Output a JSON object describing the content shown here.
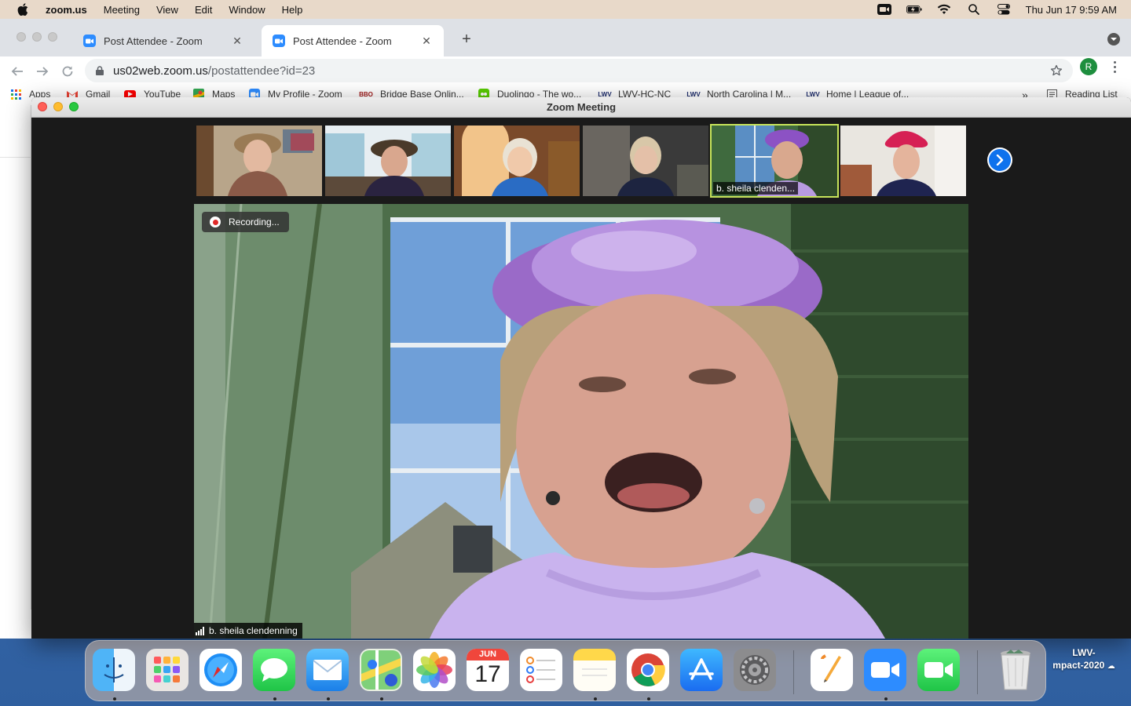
{
  "menubar": {
    "app_name": "zoom.us",
    "menus": [
      "Meeting",
      "View",
      "Edit",
      "Window",
      "Help"
    ],
    "datetime": "Thu Jun 17  9:59 AM"
  },
  "browser": {
    "tabs": [
      {
        "title": "Post Attendee - Zoom"
      },
      {
        "title": "Post Attendee - Zoom"
      }
    ],
    "url_host": "us02web.zoom.us",
    "url_path": "/postattendee?id=23",
    "profile_initial": "R",
    "bookmarks": {
      "apps": "Apps",
      "gmail": "Gmail",
      "youtube": "YouTube",
      "maps": "Maps",
      "my_profile": "My Profile - Zoom",
      "bridge": "Bridge Base Onlin...",
      "duolingo": "Duolingo - The wo...",
      "lwv": "LWV-HC-NC",
      "north_carolina": "North Carolina | M...",
      "home_league": "Home | League of...",
      "overflow": "»",
      "reading_list": "Reading List"
    }
  },
  "zoom": {
    "window_title": "Zoom Meeting",
    "recording_label": "Recording...",
    "active_thumb_name": "b. sheila clenden...",
    "speaker_name": "b. sheila clendenning"
  },
  "desktop": {
    "label_line1": "LWV-",
    "label_line2": "mpact-2020"
  },
  "dock": {
    "calendar_month": "JUN",
    "calendar_day": "17"
  },
  "colors": {
    "zoom_blue": "#2d8cff",
    "active_speaker_border": "#c7e35a",
    "recording_red": "#e02828"
  }
}
